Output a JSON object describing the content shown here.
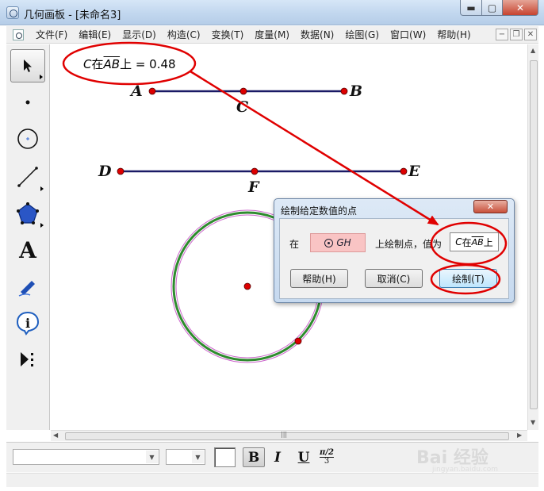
{
  "window": {
    "title": "几何画板 - [未命名3]",
    "min_symbol": "▬",
    "max_symbol": "▢",
    "close_symbol": "✕"
  },
  "menubar": {
    "items": [
      "文件(F)",
      "编辑(E)",
      "显示(D)",
      "构造(C)",
      "变换(T)",
      "度量(M)",
      "数据(N)",
      "绘图(G)",
      "窗口(W)",
      "帮助(H)"
    ],
    "mdi_min": "−",
    "mdi_restore": "❐",
    "mdi_close": "✕"
  },
  "toolbox": {
    "tools": [
      "select-arrow-icon",
      "point-icon",
      "compass-icon",
      "straightedge-icon",
      "polygon-icon",
      "text-icon",
      "marker-icon",
      "information-icon",
      "custom-tool-icon"
    ],
    "text_tool_glyph": "A",
    "info_tool_glyph": "i"
  },
  "canvas": {
    "measurement": {
      "prefix": "C",
      "in_word": "在",
      "segment": "AB",
      "on_word": "上",
      "equals": " = 0.48"
    },
    "points": {
      "A": "A",
      "B": "B",
      "C": "C",
      "D": "D",
      "E": "E",
      "F": "F"
    }
  },
  "dialog": {
    "title": "绘制给定数值的点",
    "close_symbol": "✕",
    "on_label": "在",
    "object_name": "GH",
    "draw_point_label": "上绘制点，值为",
    "value": {
      "prefix": "C",
      "in_word": "在",
      "segment": "AB",
      "on_word": "上"
    },
    "help_button": "帮助(H)",
    "cancel_button": "取消(C)",
    "draw_button": "绘制(T)"
  },
  "textbar": {
    "bold": "B",
    "italic": "I",
    "underline": "U",
    "math_num": "π/2",
    "math_den": "3"
  },
  "watermark": {
    "text": "Bai 经验",
    "sub": "jingyan.baidu.com"
  },
  "colors": {
    "segment": "#1a1a66",
    "point": "#dd0000",
    "circle": "#2e8b2e",
    "annotation": "#e00000",
    "circle_highlight": "#cc66cc"
  }
}
